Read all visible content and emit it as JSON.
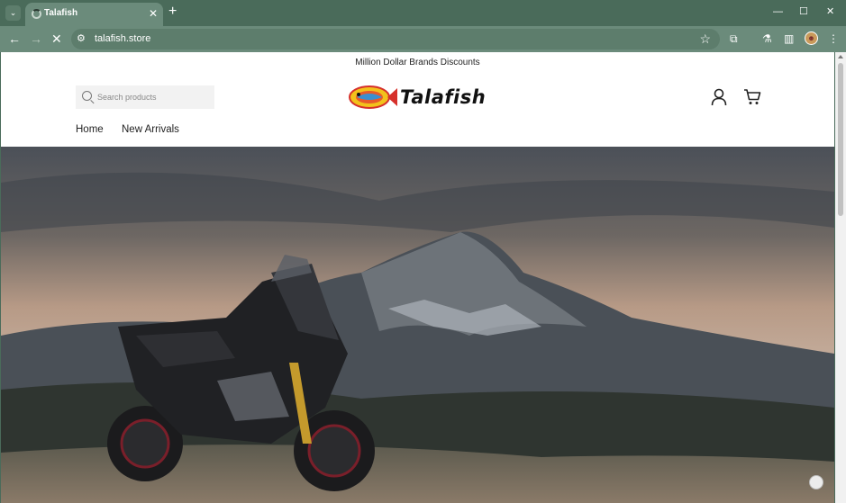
{
  "browser": {
    "tab_title": "Talafish",
    "url": "talafish.store",
    "icons": [
      "tab-list-icon",
      "loading-spinner-icon",
      "close-icon",
      "plus-icon",
      "minimize-icon",
      "maximize-icon",
      "close-window-icon",
      "back-arrow-icon",
      "forward-arrow-icon",
      "stop-loading-icon",
      "site-info-icon",
      "bookmark-star-icon",
      "extensions-icon",
      "labs-icon",
      "side-panel-icon",
      "profile-avatar-icon",
      "menu-dots-icon"
    ]
  },
  "page": {
    "announcement": "Million Dollar Brands Discounts",
    "search": {
      "placeholder": "Search products",
      "value": ""
    },
    "logo_text": "Talafish",
    "nav": {
      "home": "Home",
      "new_arrivals": "New Arrivals"
    }
  },
  "colors": {
    "chrome_frame": "#4a6b5a",
    "chrome_toolbar": "#6b8b7b",
    "page_background": "#ffffff",
    "logo_fish_yellow": "#f2c21b",
    "logo_fish_red": "#d6302b"
  }
}
